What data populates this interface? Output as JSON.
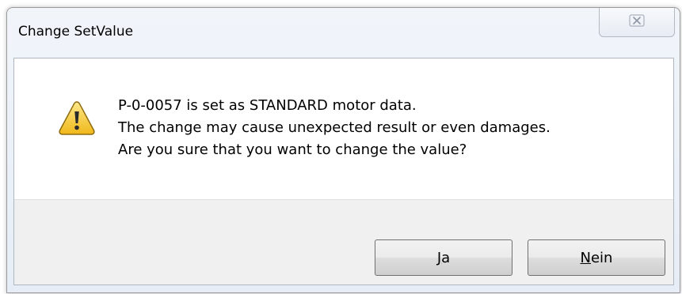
{
  "window": {
    "title": "Change SetValue",
    "close_glyph": "⊠"
  },
  "message": {
    "line1": "P-0-0057 is set as STANDARD motor data.",
    "line2": "The change may cause unexpected result or even damages.",
    "line3": "Are you sure that you want to change the value?",
    "icon": "warning-icon"
  },
  "buttons": {
    "yes": {
      "accel": "J",
      "rest": "a"
    },
    "no": {
      "accel": "N",
      "rest": "ein"
    }
  },
  "colors": {
    "warning_fill": "#f5cf3a",
    "warning_outline": "#9a7a12"
  }
}
